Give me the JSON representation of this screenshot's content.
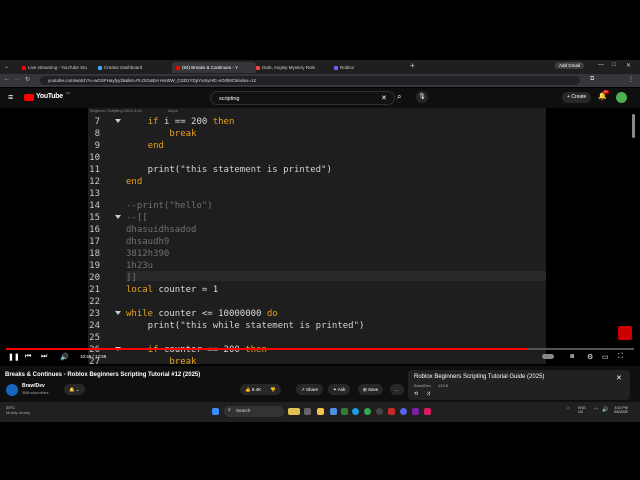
{
  "browser": {
    "tabs": [
      {
        "label": "Live streaming - YouTube Stu",
        "color": "#ff0000"
      },
      {
        "label": "Creator Dashboard",
        "color": "#3ea6ff"
      },
      {
        "label": "(84) Breaks & Continues - Y",
        "color": "#ff0000"
      },
      {
        "label": "Dark, Angsty Mystery Role",
        "color": "#ff4040"
      },
      {
        "label": "Roblox",
        "color": "#6666ff"
      }
    ],
    "new_tab": "+",
    "url": "youtube.com/watch?v=wGSFHayfyy2k&list=PLOIGaEH Hsn0W_CGDzYDpYxmyHlC-eO0lMC8index=12",
    "profile_label": "Add Gmail"
  },
  "youtube": {
    "logo": "YouTube",
    "country": "CA",
    "search_value": "scripting",
    "create_label": "Create",
    "notif_count": "9+"
  },
  "editor": {
    "file_tab1": "Beginner Scripting 2024-4.txt",
    "file_tab2": "loops",
    "lines": [
      {
        "n": "7",
        "fold": true,
        "parts": [
          {
            "t": "    ",
            "c": ""
          },
          {
            "t": "if",
            "c": "kw"
          },
          {
            "t": " i == 200 ",
            "c": ""
          },
          {
            "t": "then",
            "c": "kw"
          }
        ]
      },
      {
        "n": "8",
        "fold": false,
        "parts": [
          {
            "t": "        ",
            "c": ""
          },
          {
            "t": "break",
            "c": "kw"
          }
        ]
      },
      {
        "n": "9",
        "fold": false,
        "parts": [
          {
            "t": "    ",
            "c": ""
          },
          {
            "t": "end",
            "c": "kw"
          }
        ]
      },
      {
        "n": "10",
        "fold": false,
        "parts": [
          {
            "t": "",
            "c": ""
          }
        ]
      },
      {
        "n": "11",
        "fold": false,
        "parts": [
          {
            "t": "    print(",
            "c": ""
          },
          {
            "t": "\"this statement is printed\"",
            "c": "str"
          },
          {
            "t": ")",
            "c": ""
          }
        ]
      },
      {
        "n": "12",
        "fold": false,
        "parts": [
          {
            "t": "end",
            "c": "kw"
          }
        ]
      },
      {
        "n": "13",
        "fold": false,
        "parts": [
          {
            "t": "",
            "c": ""
          }
        ]
      },
      {
        "n": "14",
        "fold": false,
        "parts": [
          {
            "t": "--print(\"hello\")",
            "c": "cm"
          }
        ]
      },
      {
        "n": "15",
        "fold": true,
        "parts": [
          {
            "t": "--[[",
            "c": "cm"
          }
        ]
      },
      {
        "n": "16",
        "fold": false,
        "parts": [
          {
            "t": "dhasuidhsadod",
            "c": "cm"
          }
        ]
      },
      {
        "n": "17",
        "fold": false,
        "parts": [
          {
            "t": "dhsaudh9",
            "c": "cm"
          }
        ]
      },
      {
        "n": "18",
        "fold": false,
        "parts": [
          {
            "t": "3812h390",
            "c": "cm"
          }
        ]
      },
      {
        "n": "19",
        "fold": false,
        "parts": [
          {
            "t": "1h23u",
            "c": "cm"
          }
        ]
      },
      {
        "n": "20",
        "fold": false,
        "parts": [
          {
            "t": "]]",
            "c": "cm"
          }
        ]
      },
      {
        "n": "21",
        "fold": false,
        "parts": [
          {
            "t": "local",
            "c": "kw"
          },
          {
            "t": " counter = 1",
            "c": ""
          }
        ]
      },
      {
        "n": "22",
        "fold": false,
        "parts": [
          {
            "t": "",
            "c": ""
          }
        ]
      },
      {
        "n": "23",
        "fold": true,
        "parts": [
          {
            "t": "while",
            "c": "kw"
          },
          {
            "t": " counter <= 10000000 ",
            "c": ""
          },
          {
            "t": "do",
            "c": "kw"
          }
        ]
      },
      {
        "n": "24",
        "fold": false,
        "parts": [
          {
            "t": "    print(",
            "c": ""
          },
          {
            "t": "\"this while statement is printed\"",
            "c": "str"
          },
          {
            "t": ")",
            "c": ""
          }
        ]
      },
      {
        "n": "25",
        "fold": false,
        "parts": [
          {
            "t": "",
            "c": ""
          }
        ]
      },
      {
        "n": "26",
        "fold": true,
        "parts": [
          {
            "t": "    ",
            "c": ""
          },
          {
            "t": "if",
            "c": "kw"
          },
          {
            "t": " counter == 200 ",
            "c": ""
          },
          {
            "t": "then",
            "c": "kw"
          }
        ]
      },
      {
        "n": "27",
        "fold": false,
        "parts": [
          {
            "t": "        ",
            "c": ""
          },
          {
            "t": "break",
            "c": "kw"
          }
        ]
      }
    ]
  },
  "player": {
    "time": "10:49 / 12:59",
    "progress_fraction": 0.83
  },
  "video_info": {
    "title": "Breaks & Continues - Roblox Beginners Scripting Tutorial #12 (2025)",
    "channel": "BrawlDev",
    "subscribers": "365k subscribers",
    "likes": "8.4K",
    "share_label": "Share",
    "ask_label": "Ask",
    "save_label": "Save",
    "more_label": "..."
  },
  "miniplayer": {
    "title": "Roblox Beginners Scripting Tutorial Guide (2025)",
    "channel": "BrawlDev",
    "position": "12/18"
  },
  "taskbar": {
    "weather_temp": "20°C",
    "weather_desc": "Mostly cloudy",
    "search_label": "Search",
    "lang": "ENG",
    "lang2": "US",
    "time": "8:10 PM",
    "date": "6/6/2025"
  }
}
